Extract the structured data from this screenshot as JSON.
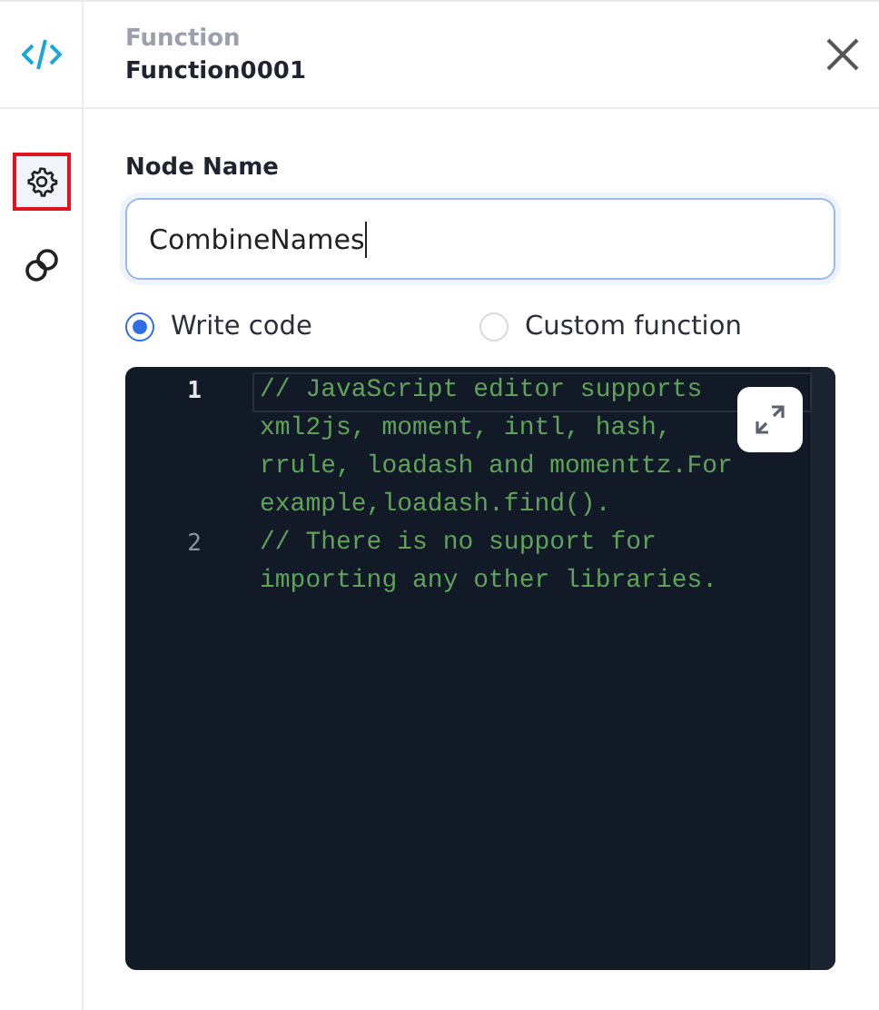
{
  "header": {
    "subtitle": "Function",
    "title": "Function0001"
  },
  "sidebar": {
    "items": [
      {
        "kind": "code",
        "selected": false
      },
      {
        "kind": "settings",
        "selected": true
      },
      {
        "kind": "link",
        "selected": false
      }
    ]
  },
  "node_name": {
    "label": "Node Name",
    "value": "CombineNames"
  },
  "mode_options": [
    {
      "label": "Write code",
      "selected": true
    },
    {
      "label": "Custom function",
      "selected": false
    }
  ],
  "editor": {
    "lines": [
      {
        "number": "1",
        "text": "// JavaScript editor supports xml2js, moment, intl, hash, rrule, loadash and momenttz.For example,loadash.find().",
        "active": true
      },
      {
        "number": "2",
        "text": "// There is no support for importing any other libraries.",
        "active": false
      }
    ]
  }
}
